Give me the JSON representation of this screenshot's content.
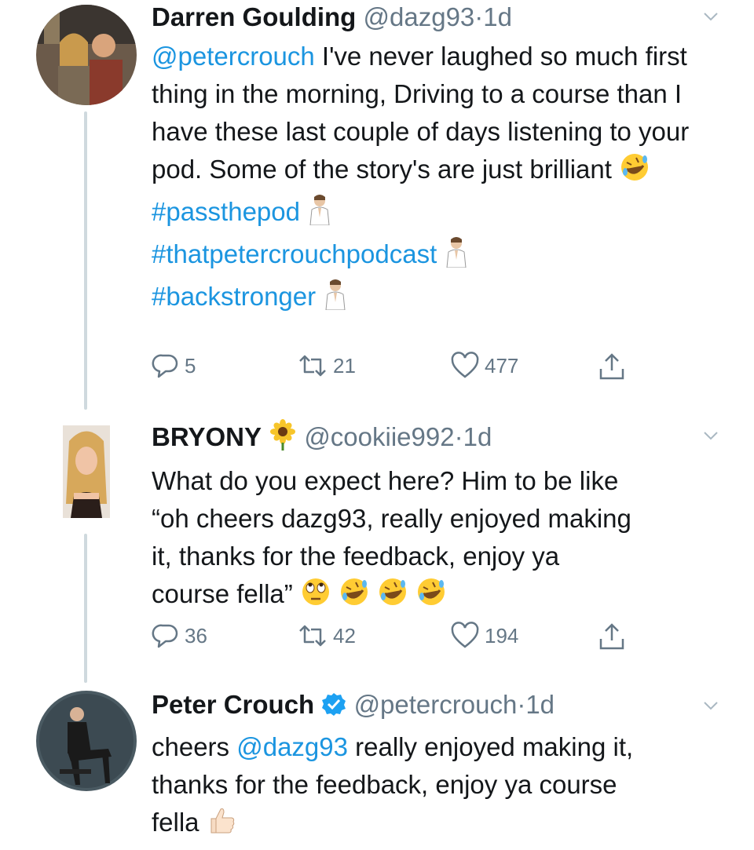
{
  "tweets": [
    {
      "name": "Darren Goulding",
      "handle": "@dazg93",
      "dot": "·",
      "time": "1d",
      "mention": "@petercrouch",
      "text": " I've never laughed so much first thing in the morning, Driving to a course than I have these last couple of days listening to your pod. Some of the story's are just brilliant",
      "hashtags": [
        "#passthepod",
        "#thatpetercrouchpodcast",
        "#backstronger"
      ],
      "emojis": [
        "rofl-emoji",
        "praying-man-emoji"
      ],
      "replies": "5",
      "retweets": "21",
      "likes": "477"
    },
    {
      "name": "BRYONY",
      "name_emoji": "sunflower-emoji",
      "handle": "@cookiie992",
      "dot": "·",
      "time": "1d",
      "line1": "What do you expect here? Him to be like",
      "line2": "“oh cheers dazg93, really enjoyed making",
      "line3": "it, thanks for the feedback, enjoy ya",
      "line4": "course fella”",
      "emojis": [
        "eye-roll-emoji",
        "rofl-emoji"
      ],
      "replies": "36",
      "retweets": "42",
      "likes": "194"
    },
    {
      "name": "Peter Crouch",
      "verified": "verified-badge-icon",
      "handle": "@petercrouch",
      "dot": "·",
      "time": "1d",
      "pre": "cheers ",
      "mention": "@dazg93",
      "text1": " really enjoyed making it,",
      "text2": "thanks for the feedback, enjoy ya course",
      "text3": "fella",
      "emojis": [
        "thumbs-up-emoji"
      ]
    }
  ],
  "colors": {
    "link": "#1b95e0",
    "muted": "#657786",
    "thread": "#cfd9de"
  }
}
